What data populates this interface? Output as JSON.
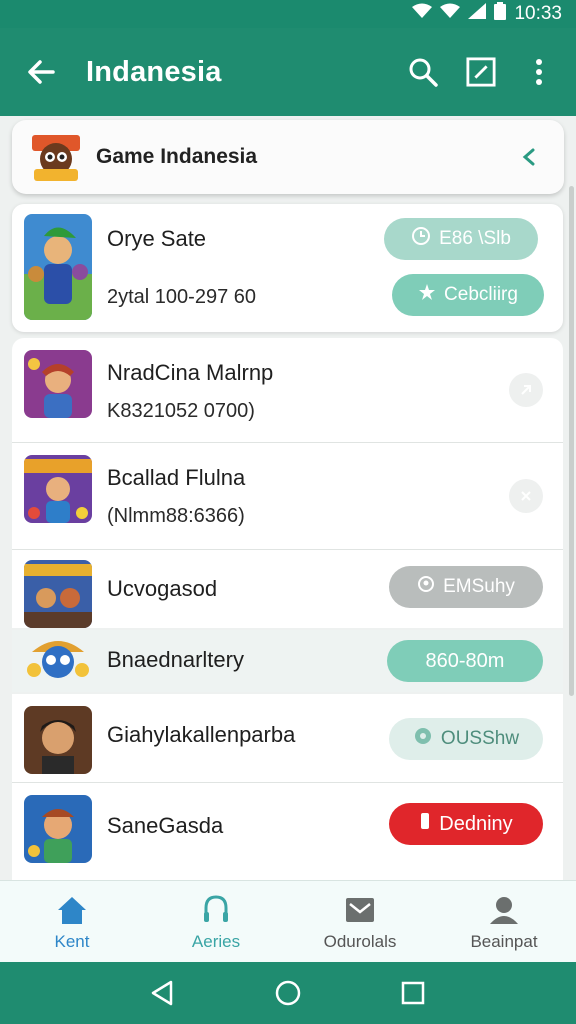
{
  "status_bar": {
    "time": "10:33"
  },
  "app_bar": {
    "title": "Indanesia"
  },
  "header_card": {
    "title": "Game Indanesia"
  },
  "items": [
    {
      "name": "Orye Sate",
      "sub": "2ytal 100-297 60",
      "action_top": "E86 \\Slb",
      "action_bottom": "Cebcliirg"
    },
    {
      "name": "NradCina Malrnp",
      "sub": "K8321052 0700)"
    },
    {
      "name": "Bcallad Flulna",
      "sub": "(Nlmm88:6366)"
    },
    {
      "name": "Ucvogasod",
      "action": "EMSuhy"
    },
    {
      "name": "Bnaednarltery",
      "action": "860-80m"
    },
    {
      "name": "Giahylakallenparba",
      "action": "OUSShw"
    },
    {
      "name": "SaneGasda",
      "action": "Dedniny"
    }
  ],
  "bottom_nav": [
    {
      "label": "Kent",
      "icon": "home-icon"
    },
    {
      "label": "Aeries",
      "icon": "headset-icon"
    },
    {
      "label": "Odurolals",
      "icon": "mail-icon"
    },
    {
      "label": "Beainpat",
      "icon": "profile-icon"
    }
  ],
  "colors": {
    "primary": "#1f8c70",
    "teal_pill": "#7fcdb8",
    "red_pill": "#e0262b",
    "active_nav": "#2e86c8"
  }
}
